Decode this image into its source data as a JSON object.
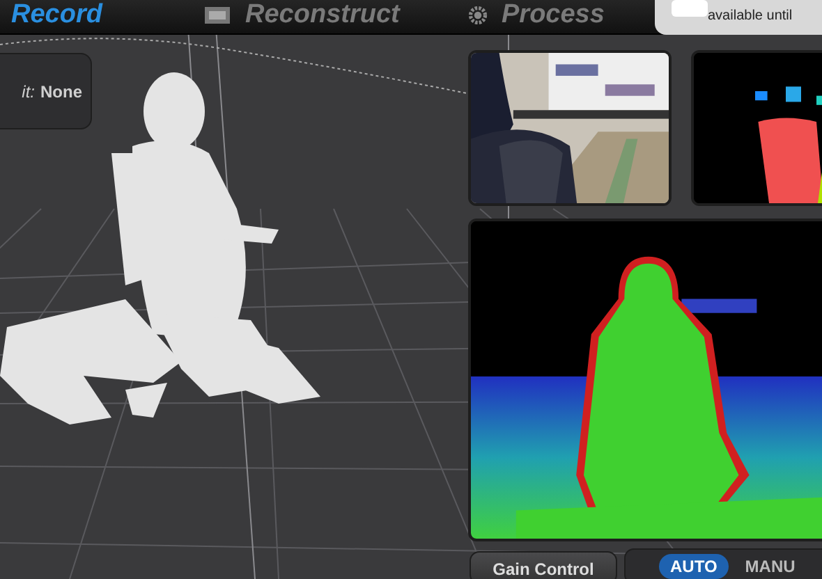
{
  "tabs": [
    {
      "label": "Record",
      "selected": true,
      "kind": "plain"
    },
    {
      "label": "Reconstruct",
      "selected": false,
      "kind": "film"
    },
    {
      "label": "Process",
      "selected": false,
      "kind": "gear"
    }
  ],
  "notice": {
    "text": "available until",
    "checked": false
  },
  "info_box": {
    "label": "it:",
    "value": "None"
  },
  "gain_control": {
    "label": "Gain Control"
  },
  "mode_toggle": [
    {
      "label": "AUTO",
      "selected": true
    },
    {
      "label": "MANU",
      "selected": false
    }
  ]
}
